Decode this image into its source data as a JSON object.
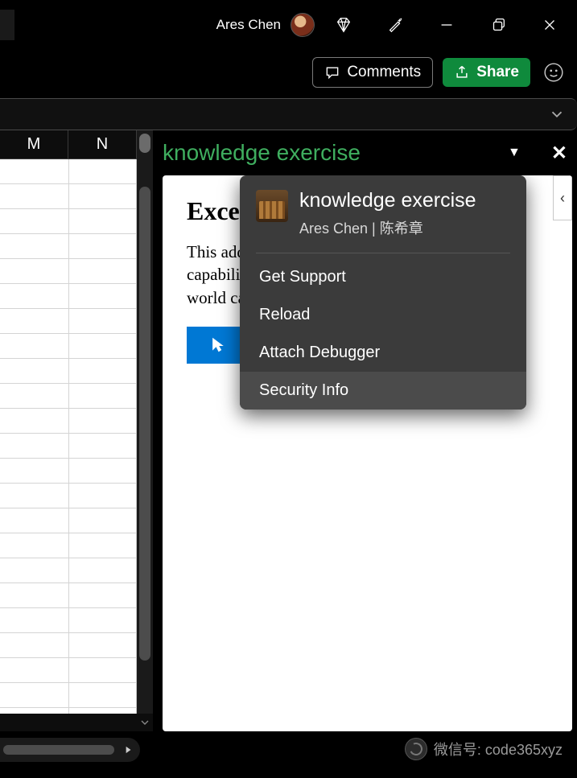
{
  "titlebar": {
    "username": "Ares Chen"
  },
  "actionbar": {
    "comments_label": "Comments",
    "share_label": "Share"
  },
  "sheet": {
    "columns": [
      "M",
      "N"
    ]
  },
  "taskpane": {
    "title": "knowledge exercise",
    "heading": "Excel",
    "body_visible": "This add-\ncapability\nworld can"
  },
  "popup": {
    "title": "knowledge exercise",
    "subtitle": "Ares Chen | 陈希章",
    "items": [
      {
        "label": "Get Support",
        "hover": false
      },
      {
        "label": "Reload",
        "hover": false
      },
      {
        "label": "Attach Debugger",
        "hover": false
      },
      {
        "label": "Security Info",
        "hover": true
      }
    ]
  },
  "watermark": {
    "text": "微信号: code365xyz"
  }
}
